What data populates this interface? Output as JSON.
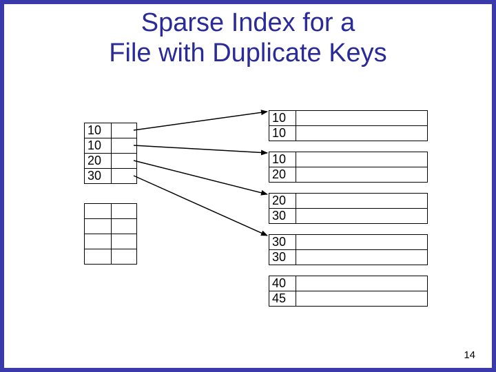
{
  "title_line1": "Sparse Index for a",
  "title_line2": "File with Duplicate Keys",
  "page_number": "14",
  "index_block1": [
    "10",
    "10",
    "20",
    "30"
  ],
  "index_block2": [
    "",
    "",
    "",
    ""
  ],
  "data_blocks": [
    [
      "10",
      "10"
    ],
    [
      "10",
      "20"
    ],
    [
      "20",
      "30"
    ],
    [
      "30",
      "30"
    ],
    [
      "40",
      "45"
    ]
  ],
  "layout": {
    "index1_top": 178,
    "index1_left": 122,
    "index2_top": 295,
    "index2_left": 122,
    "data_left": 390,
    "data_tops": [
      160,
      220,
      280,
      340,
      400
    ],
    "idx_cell_w": 70,
    "idx_row_h": 22,
    "data_row_h": 22
  },
  "arrows_from_to": [
    {
      "from_idx_row": 0,
      "to_block": 0
    },
    {
      "from_idx_row": 1,
      "to_block": 1
    },
    {
      "from_idx_row": 2,
      "to_block": 2
    },
    {
      "from_idx_row": 3,
      "to_block": 3
    }
  ]
}
